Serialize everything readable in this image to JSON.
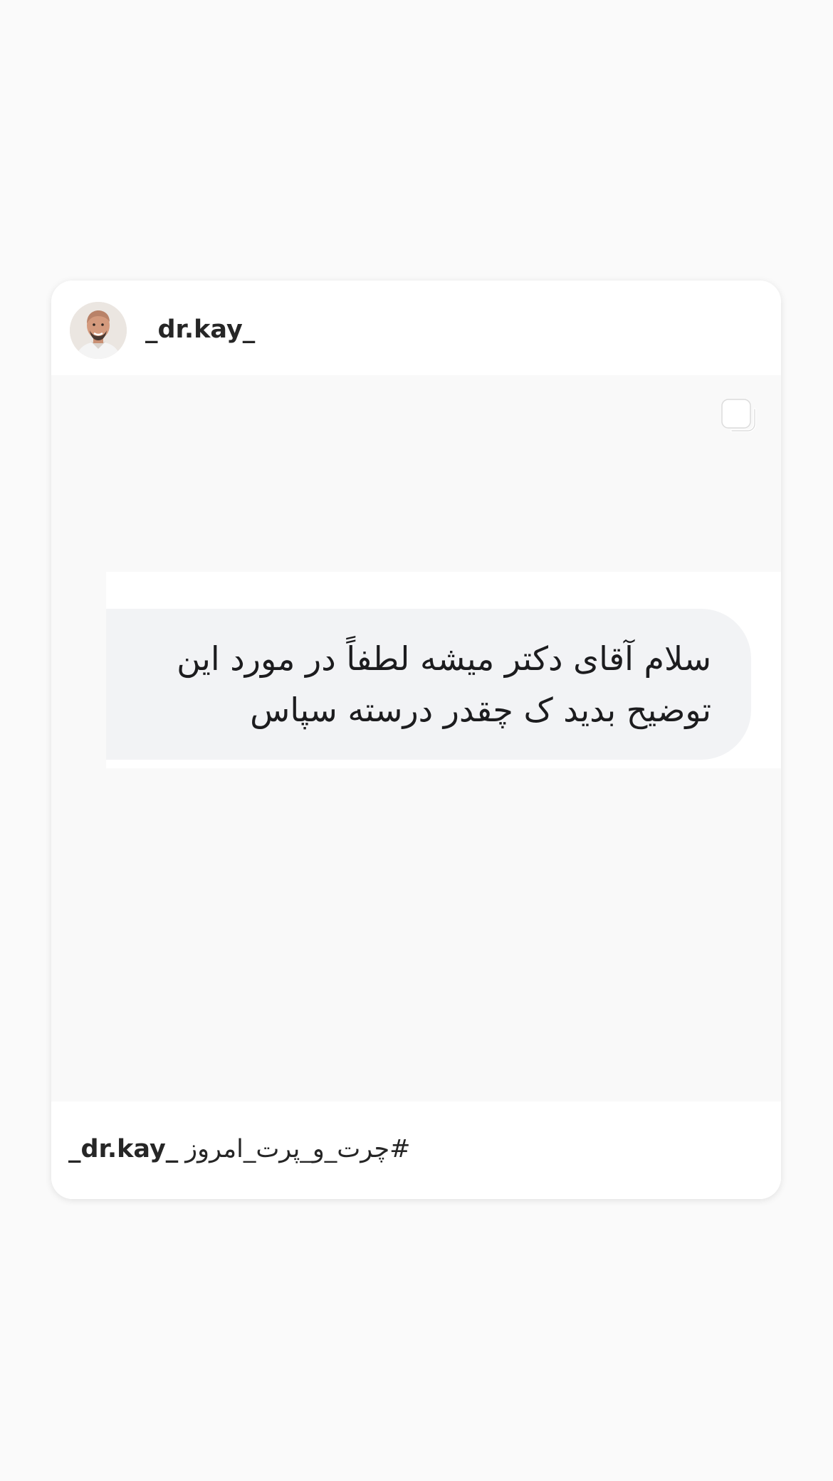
{
  "post": {
    "username": "_dr.kay_",
    "media": {
      "multi_image_icon": "carousel-icon",
      "message": "سلام آقای دکتر میشه لطفاً در مورد این توضیح بدید ک چقدر درسته سپاس"
    },
    "caption": {
      "username": "_dr.kay_",
      "hashtag": "#چرت_و_پرت_امروز"
    }
  },
  "colors": {
    "page_background": "#fafafa",
    "card_background": "#ffffff",
    "media_background": "#f9f9f9",
    "bubble_background": "#f2f3f5",
    "text": "#262626"
  }
}
